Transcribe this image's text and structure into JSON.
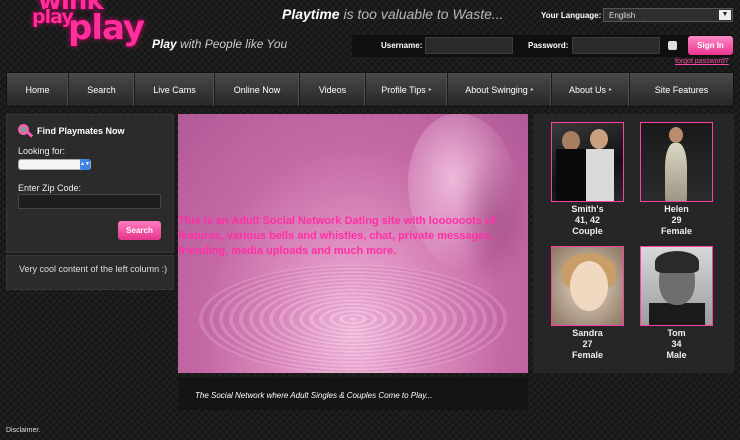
{
  "logo": {
    "wink": "wink",
    "play1": "play",
    "play2": "play"
  },
  "header": {
    "slogan_highlight": "Playtime",
    "slogan_rest": " is too valuable to Waste...",
    "tagline_highlight": "Play",
    "tagline_rest": " with People like You",
    "language_label": "Your Language:",
    "language_value": "English",
    "username_label": "Username:",
    "password_label": "Password:",
    "signin_label": "Sign In",
    "forgot_label": "forgot password?"
  },
  "nav": {
    "items": [
      {
        "label": "Home"
      },
      {
        "label": "Search"
      },
      {
        "label": "Live Cams"
      },
      {
        "label": "Online Now"
      },
      {
        "label": "Videos"
      },
      {
        "label": "Profile Tips"
      },
      {
        "label": "About Swinging"
      },
      {
        "label": "About Us"
      },
      {
        "label": "Site Features"
      }
    ],
    "arrow": "▸"
  },
  "find": {
    "title": "Find Playmates Now",
    "looking_label": "Looking for:",
    "zip_label": "Enter Zip Code:",
    "search_label": "Search"
  },
  "left_note": "Very cool content of the left column :)",
  "hero": {
    "text": "This is an Adult Social Network Dating site with loooooots of features, various bells and whistles, chat, private messages, friending, media uploads and much more.",
    "caption": "The Social Network where Adult Singles & Couples Come to Play..."
  },
  "members": [
    {
      "name": "Smith's",
      "age": "41, 42",
      "type": "Couple"
    },
    {
      "name": "Helen",
      "age": "29",
      "type": "Female"
    },
    {
      "name": "Sandra",
      "age": "27",
      "type": "Female"
    },
    {
      "name": "Tom",
      "age": "34",
      "type": "Male"
    }
  ],
  "footer": {
    "disclaimer": "Disclaimer."
  },
  "colors": {
    "accent": "#ff2f9c",
    "background": "#1c1c1c"
  }
}
